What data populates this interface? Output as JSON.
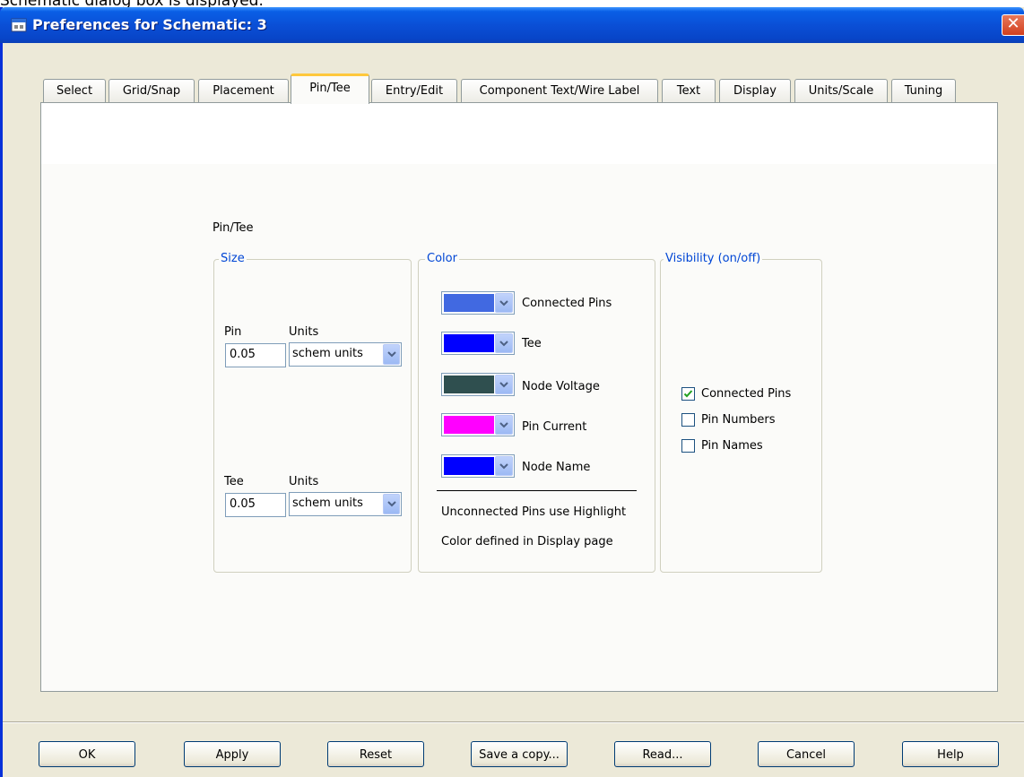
{
  "caption": "Schematic dialog box is displayed.",
  "window": {
    "title": "Preferences for Schematic: 3",
    "close_glyph": "✕"
  },
  "tabs": [
    {
      "label": "Select",
      "active": false
    },
    {
      "label": "Grid/Snap",
      "active": false
    },
    {
      "label": "Placement",
      "active": false
    },
    {
      "label": "Pin/Tee",
      "active": true
    },
    {
      "label": "Entry/Edit",
      "active": false
    },
    {
      "label": "Component Text/Wire Label",
      "active": false
    },
    {
      "label": "Text",
      "active": false
    },
    {
      "label": "Display",
      "active": false
    },
    {
      "label": "Units/Scale",
      "active": false
    },
    {
      "label": "Tuning",
      "active": false
    }
  ],
  "panel": {
    "heading": "Pin/Tee",
    "size_group": {
      "legend": "Size",
      "pin": {
        "label": "Pin",
        "value": "0.05",
        "units_label": "Units",
        "units_value": "schem units"
      },
      "tee": {
        "label": "Tee",
        "value": "0.05",
        "units_label": "Units",
        "units_value": "schem units"
      }
    },
    "color_group": {
      "legend": "Color",
      "items": [
        {
          "label": "Connected Pins",
          "color": "#4169e1"
        },
        {
          "label": "Tee",
          "color": "#0000ff"
        },
        {
          "label": "Node Voltage",
          "color": "#2f4f4f"
        },
        {
          "label": "Pin Current",
          "color": "#ff00ff"
        },
        {
          "label": "Node Name",
          "color": "#0000ff"
        }
      ],
      "note_line1": "Unconnected Pins use Highlight",
      "note_line2": "Color defined in Display page"
    },
    "visibility_group": {
      "legend": "Visibility (on/off)",
      "items": [
        {
          "label": "Connected Pins",
          "checked": true
        },
        {
          "label": "Pin Numbers",
          "checked": false
        },
        {
          "label": "Pin Names",
          "checked": false
        }
      ]
    }
  },
  "buttons": {
    "ok": "OK",
    "apply": "Apply",
    "reset": "Reset",
    "save_copy": "Save a copy...",
    "read": "Read...",
    "cancel": "Cancel",
    "help": "Help"
  }
}
